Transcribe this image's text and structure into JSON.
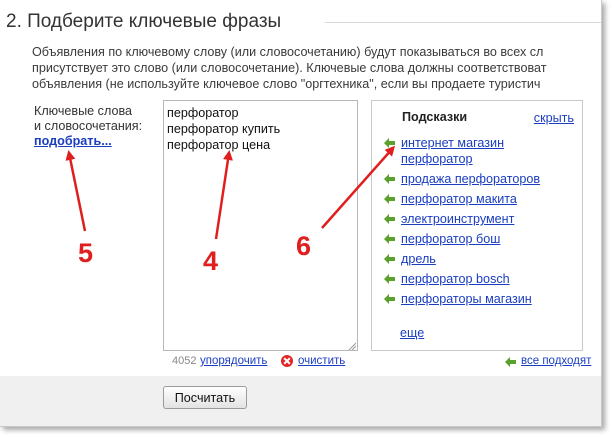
{
  "section": {
    "title": "2. Подберите ключевые фразы"
  },
  "description": {
    "lines": [
      "Объявления по ключевому слову (или словосочетанию) будут показываться во всех сл",
      "присутствует это слово (или словосочетание). Ключевые слова должны соответствоват",
      "объявления (не используйте ключевое слово \"оргтехника\", если вы продаете туристич"
    ]
  },
  "keywords": {
    "label_line1": "Ключевые слова",
    "label_line2": "и словосочетания:",
    "pick_link": "подобрать...",
    "value": "перфоратор\nперфоратор купить\nперфоратор цена",
    "counter": "4052",
    "sort_link": "упорядочить",
    "clear_link": "очистить"
  },
  "hints": {
    "title": "Подсказки",
    "hide_link": "скрыть",
    "items": [
      "интернет магазин перфоратор",
      "продажа перфораторов",
      "перфоратор макита",
      "электроинструмент",
      "перфоратор бош",
      "дрель",
      "перфоратор bosch",
      "перфораторы магазин"
    ],
    "more_link": "еще",
    "all_fit_link": "все подходят"
  },
  "actions": {
    "calculate_label": "Посчитать"
  },
  "annotations": {
    "labels": [
      "5",
      "4",
      "6"
    ],
    "color": "#e01e1e"
  },
  "colors": {
    "link": "#1a3dc1",
    "arrow_green": "#5aa02c",
    "footer_bg": "#f0f0f0"
  }
}
